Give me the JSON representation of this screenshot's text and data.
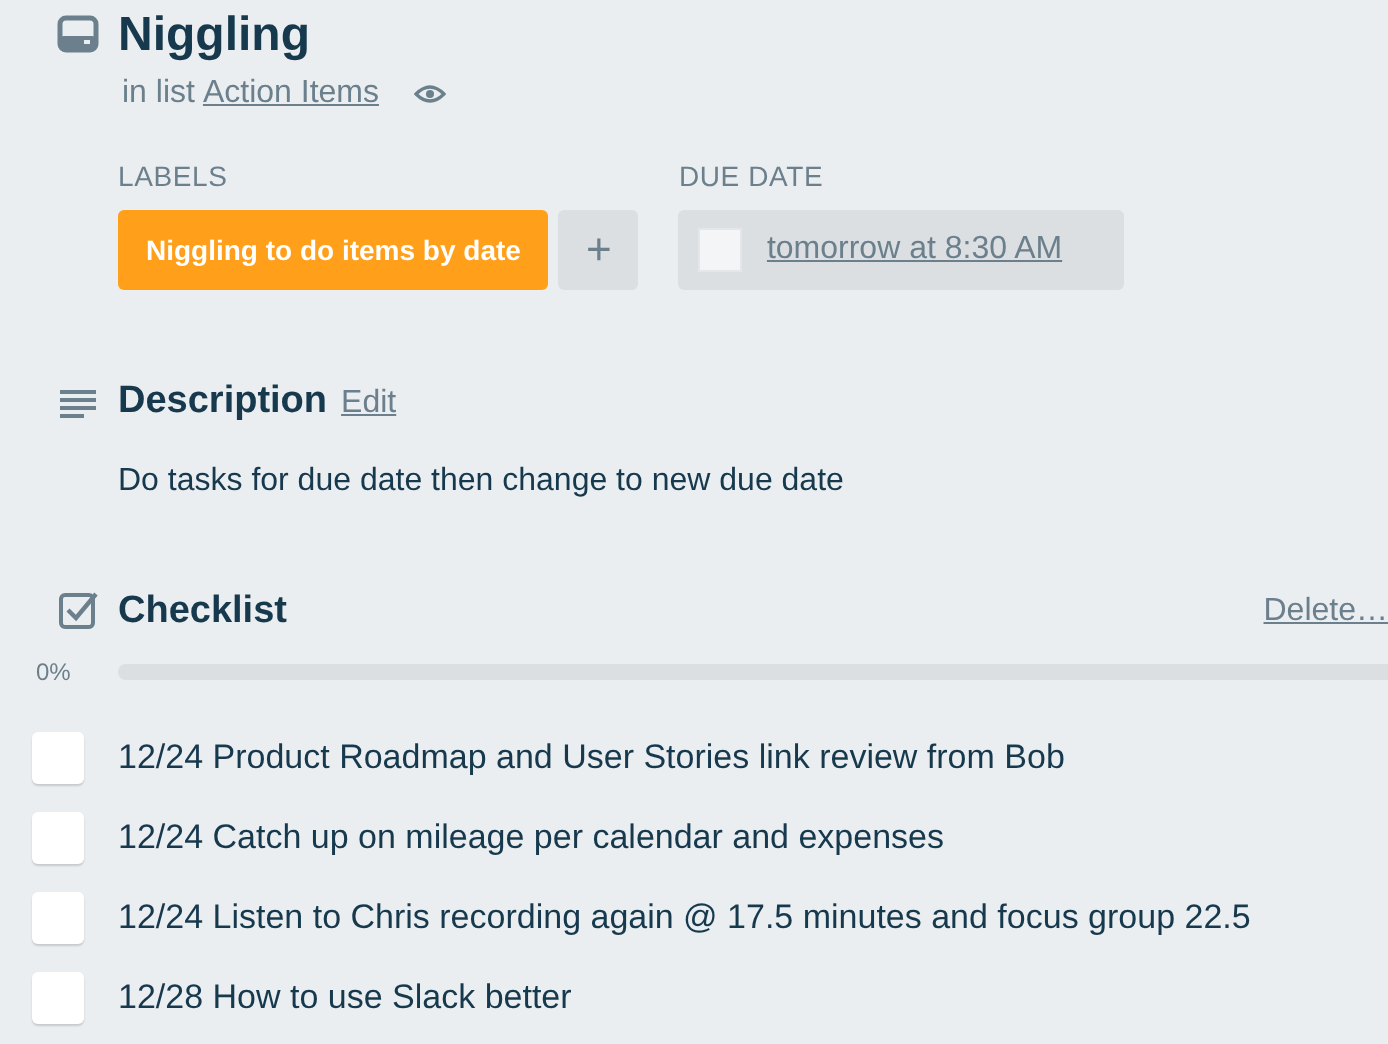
{
  "card": {
    "title": "Niggling",
    "list_prefix": "in list",
    "list_name": "Action Items",
    "watching": true
  },
  "labels": {
    "heading": "LABELS",
    "items": [
      {
        "text": "Niggling to do items by date",
        "color": "#ff9f1a"
      }
    ],
    "add": "+"
  },
  "due_date": {
    "heading": "DUE DATE",
    "value": "tomorrow at 8:30 AM",
    "complete": false
  },
  "description": {
    "heading": "Description",
    "edit": "Edit",
    "text": "Do tasks for due date then change to new due date"
  },
  "checklist": {
    "heading": "Checklist",
    "delete": "Delete…",
    "percent": "0%",
    "level": 0,
    "items": [
      {
        "text": "12/24 Product Roadmap and User Stories link review from Bob",
        "checked": false
      },
      {
        "text": "12/24 Catch up on mileage per calendar and expenses",
        "checked": false
      },
      {
        "text": "12/24 Listen to Chris recording again @ 17.5 minutes and focus group 22.5",
        "checked": false
      },
      {
        "text": "12/28 How to use Slack better",
        "checked": false
      }
    ]
  }
}
